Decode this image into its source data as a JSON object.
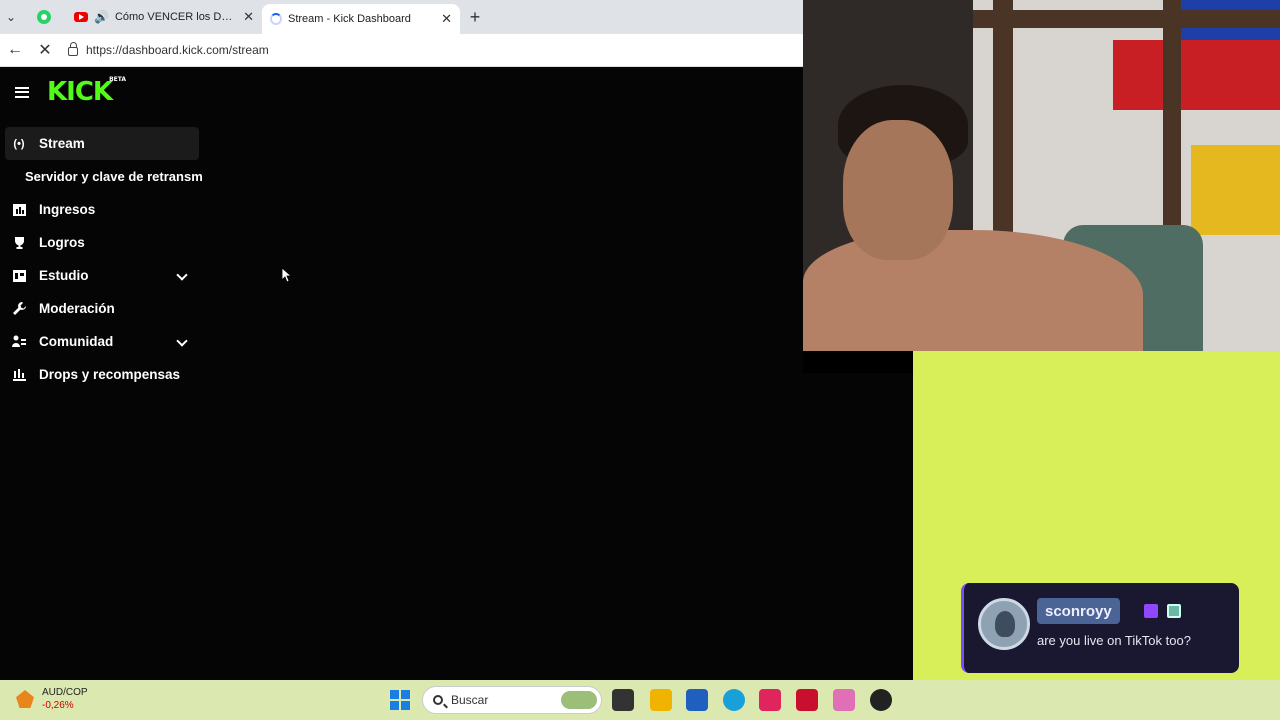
{
  "browser": {
    "tabs": [
      {
        "title": "Cómo VENCER los Deseos Sexuales",
        "active": false
      },
      {
        "title": "Stream - Kick Dashboard",
        "active": true
      }
    ],
    "url": "https://dashboard.kick.com/stream"
  },
  "kick": {
    "logo_text": "KICK",
    "logo_badge": "BETA",
    "menu": [
      {
        "label": "Stream",
        "icon": "broadcast-icon",
        "active": true
      },
      {
        "label": "Servidor y clave de retransm",
        "sub": true
      },
      {
        "label": "Ingresos",
        "icon": "bar-chart-icon"
      },
      {
        "label": "Logros",
        "icon": "trophy-icon"
      },
      {
        "label": "Estudio",
        "icon": "studio-icon",
        "expandable": true
      },
      {
        "label": "Moderación",
        "icon": "wrench-icon"
      },
      {
        "label": "Comunidad",
        "icon": "community-icon",
        "expandable": true
      },
      {
        "label": "Drops y recompensas",
        "icon": "drops-icon"
      }
    ]
  },
  "chat_overlay": {
    "username": "sconroyy",
    "message": "are you live on TikTok too?"
  },
  "taskbar": {
    "ticker_pair": "AUD/COP",
    "ticker_change": "-0,26%",
    "search_placeholder": "Buscar"
  }
}
